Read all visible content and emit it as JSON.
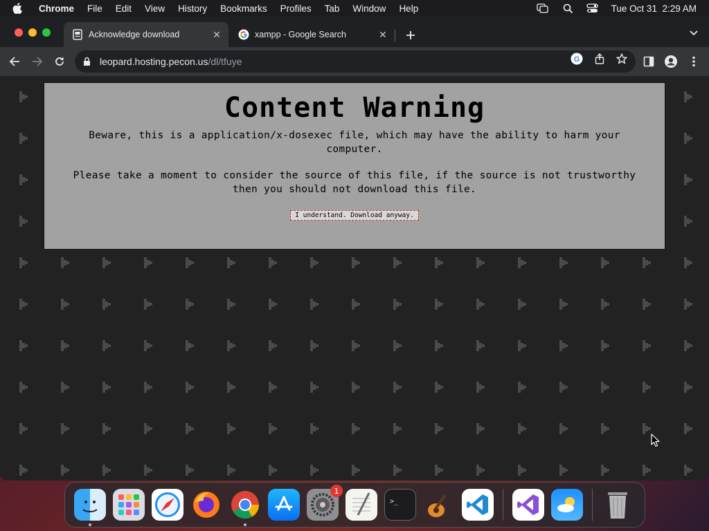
{
  "menubar": {
    "app_name": "Chrome",
    "items": [
      "File",
      "Edit",
      "View",
      "History",
      "Bookmarks",
      "Profiles",
      "Tab",
      "Window",
      "Help"
    ],
    "clock": "Tue Oct 31  2:29 AM"
  },
  "tabs": [
    {
      "title": "Acknowledge download",
      "active": true
    },
    {
      "title": "xampp - Google Search",
      "active": false
    }
  ],
  "omnibox": {
    "host": "leopard.hosting.pecon.us",
    "path": "/dl/tfuye"
  },
  "page": {
    "title": "Content Warning",
    "paragraph1": "Beware, this is a application/x-dosexec file, which may have the ability to harm your computer.",
    "paragraph2": "Please take a moment to consider the source of this file, if the source is not trustworthy then you should not download this file.",
    "button_label": "I understand. Download anyway."
  },
  "dock": {
    "apps": [
      "Finder",
      "Launchpad",
      "Safari",
      "Firefox",
      "Google Chrome",
      "App Store",
      "System Settings",
      "TextEdit",
      "Terminal",
      "GarageBand",
      "Visual Studio Code",
      "Visual Studio",
      "Weather",
      "Trash"
    ],
    "settings_badge": "1"
  },
  "colors": {
    "accent_red": "#fe5f57",
    "warning_bg": "#a2a2a2",
    "page_bg": "#222222",
    "tab_active": "#35363a"
  }
}
